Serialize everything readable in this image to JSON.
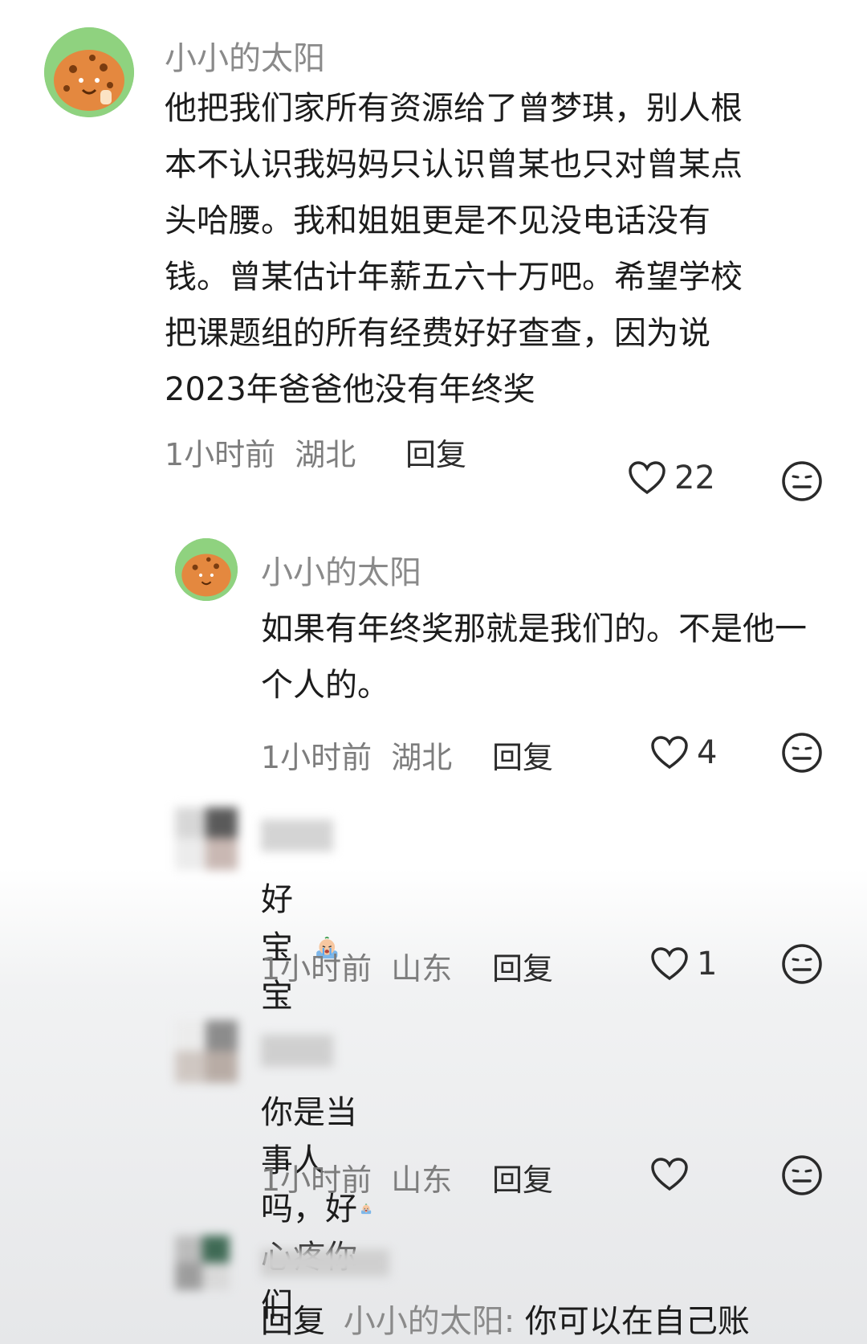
{
  "comments": [
    {
      "username": "小小的太阳",
      "text": "他把我们家所有资源给了曾梦琪，别人根本不认识我妈妈只认识曾某也只对曾某点头哈腰。我和姐姐更是不见没电话没有钱。曾某估计年薪五六十万吧。希望学校把课题组的所有经费好好查查，因为说2023年爸爸他没有年终奖",
      "time": "1小时前",
      "location": "湖北",
      "reply_label": "回复",
      "likes": "22"
    },
    {
      "username": "小小的太阳",
      "text": "如果有年终奖那就是我们的。不是他一个人的。",
      "time": "1小时前",
      "location": "湖北",
      "reply_label": "回复",
      "likes": "4"
    },
    {
      "username": "",
      "text": "好宝宝",
      "time": "1小时前",
      "location": "山东",
      "reply_label": "回复",
      "likes": "1"
    },
    {
      "username": "",
      "text": "你是当事人吗，好心疼你们",
      "time": "1小时前",
      "location": "山东",
      "reply_label": "回复",
      "likes": ""
    },
    {
      "username": "",
      "reply_prefix": "回复",
      "reply_to": "小小的太阳:",
      "text": "你可以在自己账"
    }
  ],
  "icons": {
    "like": "heart-icon",
    "dislike": "meh-face-icon",
    "emoji": "crying-emoji-icon"
  },
  "colors": {
    "username": "#8a8a8a",
    "text": "#1c1c1c",
    "meta": "#7d7d7d"
  }
}
